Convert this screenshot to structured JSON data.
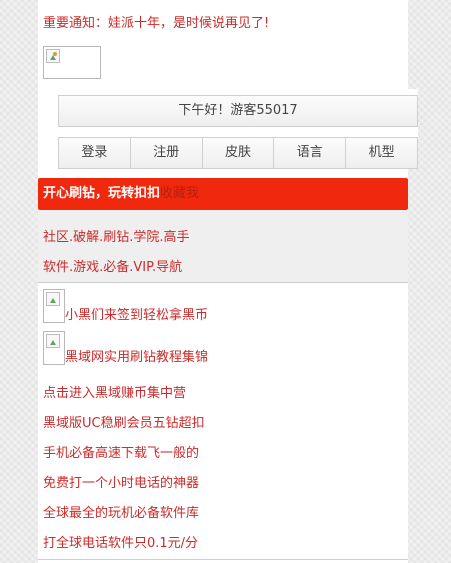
{
  "notice": "重要通知：娃派十年，是时候说再见了!",
  "greeting": "下午好！游客55017",
  "menu": [
    "登录",
    "注册",
    "皮肤",
    "语言",
    "机型"
  ],
  "banner": {
    "bold_text": "开心刷钻，玩转扣扣",
    "favorite_label": "收藏我"
  },
  "nav_lines": [
    "社区.破解.刷钻.学院.高手",
    "软件.游戏.必备.VIP.导航"
  ],
  "links": [
    "小黑们来签到轻松拿黑币",
    "黑域网实用刷钻教程集锦",
    "点击进入黑域赚币集中营",
    "黑域版UC稳刷会员五钻超扣",
    "手机必备高速下载飞一般的",
    "免费打一个小时电话的神器",
    "全球最全的玩机必备软件库",
    "打全球电话软件只0.1元/分"
  ]
}
